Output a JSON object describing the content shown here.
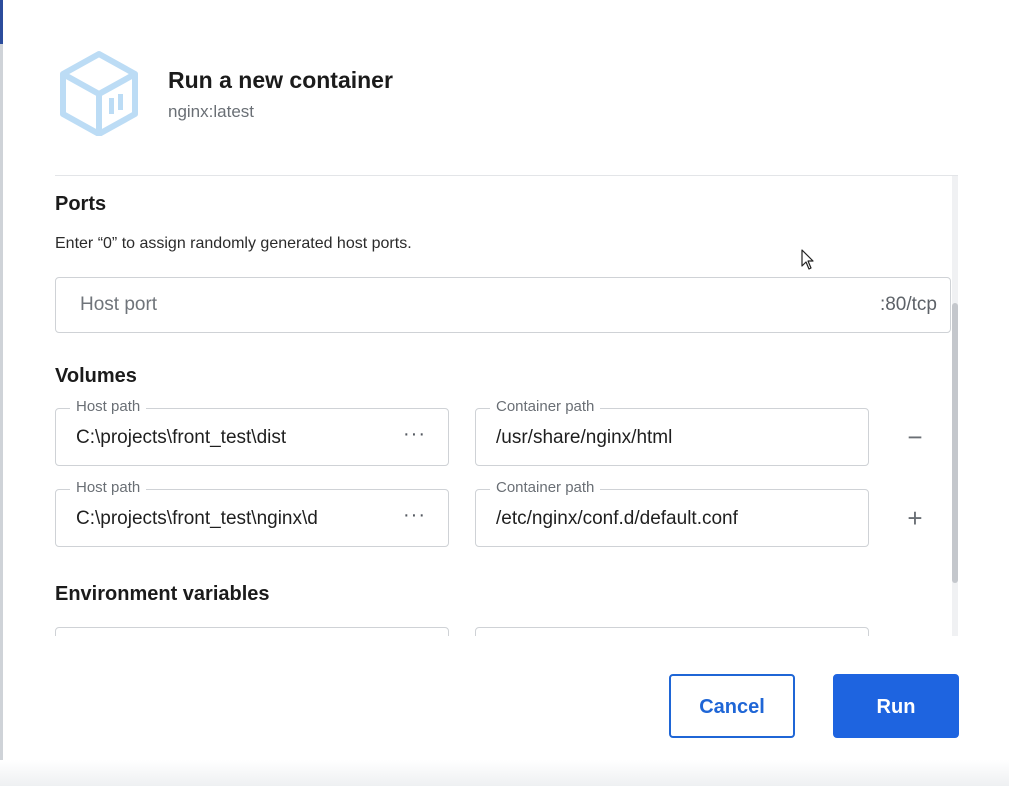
{
  "dialog": {
    "title": "Run a new container",
    "subtitle": "nginx:latest",
    "icon": "container-box-icon"
  },
  "ports": {
    "title": "Ports",
    "hint": "Enter “0” to assign randomly generated host ports.",
    "host_port_placeholder": "Host port",
    "host_port_value": "",
    "container_port": ":80/tcp"
  },
  "volumes": {
    "title": "Volumes",
    "rows": [
      {
        "host_label": "Host path",
        "host_value": "C:\\projects\\front_test\\dist",
        "container_label": "Container path",
        "container_value": "/usr/share/nginx/html",
        "more_label": "···",
        "action": "remove",
        "action_symbol": "−"
      },
      {
        "host_label": "Host path",
        "host_value": "C:\\projects\\front_test\\nginx\\d",
        "container_label": "Container path",
        "container_value": "/etc/nginx/conf.d/default.conf",
        "more_label": "···",
        "action": "add",
        "action_symbol": "+"
      }
    ]
  },
  "environment": {
    "title": "Environment variables"
  },
  "footer": {
    "cancel_label": "Cancel",
    "run_label": "Run"
  },
  "colors": {
    "primary": "#1e64e0",
    "icon": "#bcdcf5"
  }
}
